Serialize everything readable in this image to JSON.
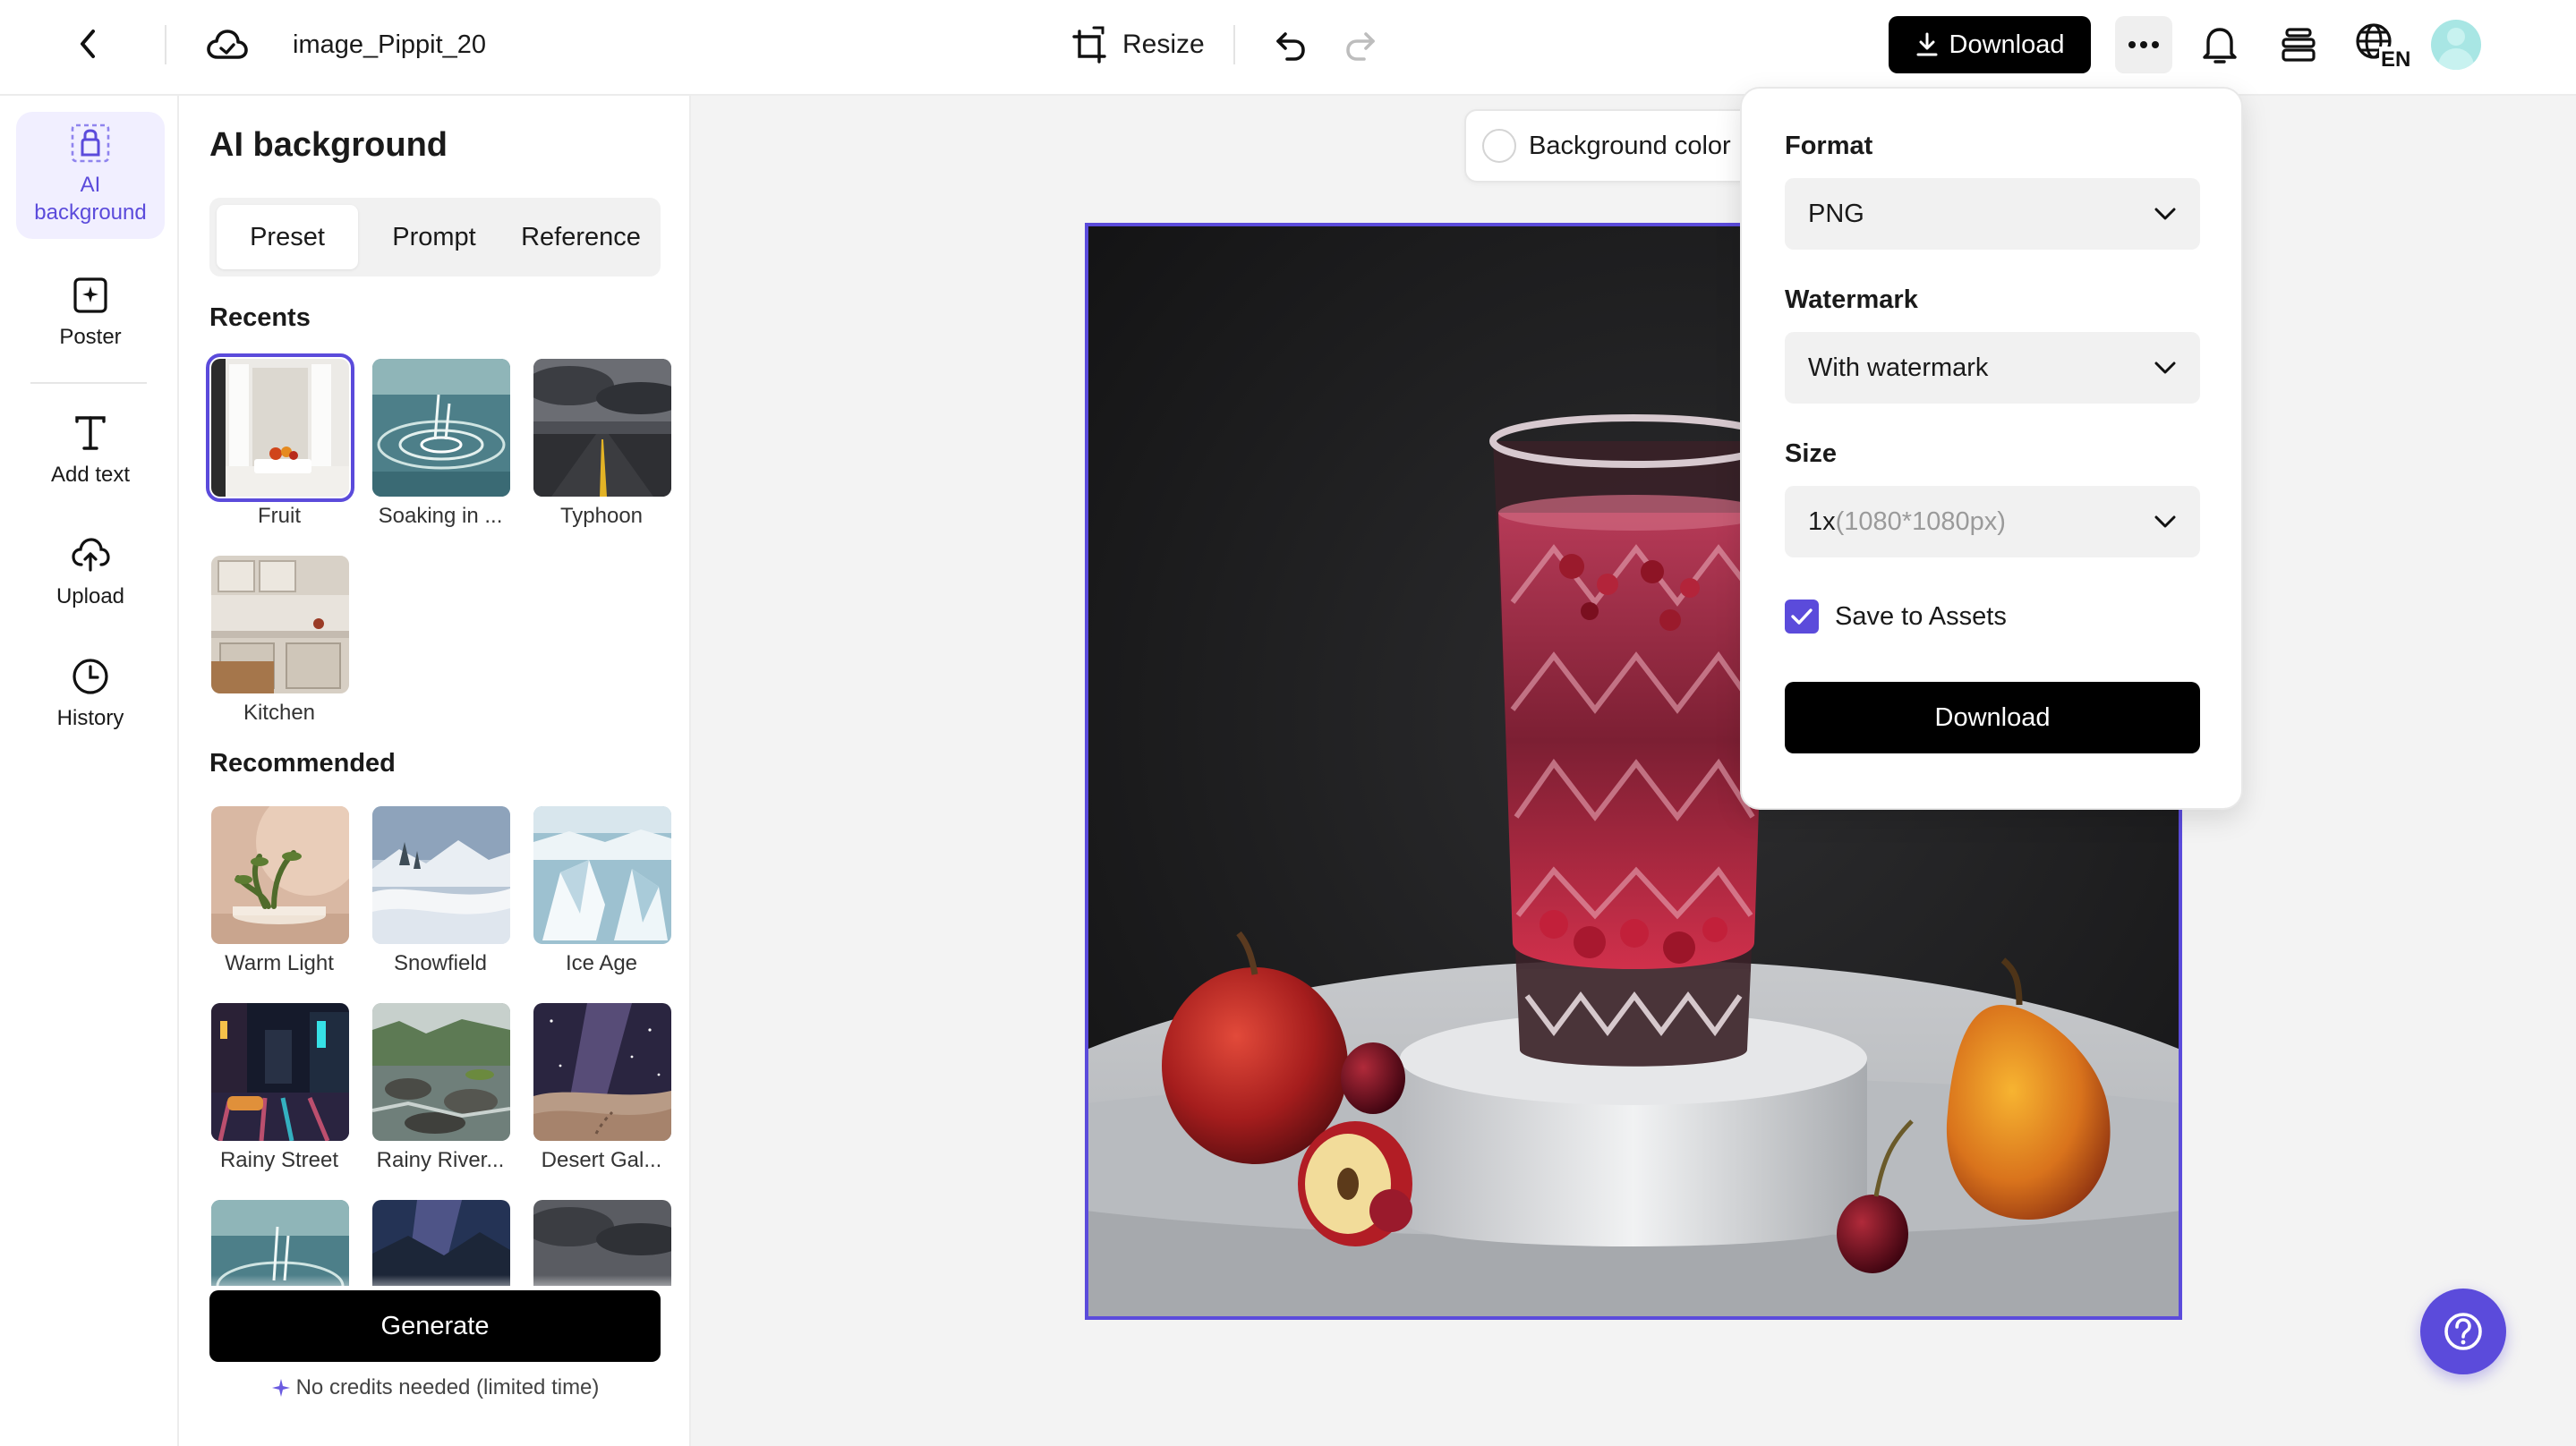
{
  "header": {
    "file_name": "image_Pippit_20",
    "resize_label": "Resize",
    "download_label": "Download",
    "language_code": "EN"
  },
  "rail": {
    "items": [
      {
        "label": "AI background",
        "icon": "ai-background-icon",
        "active": true
      },
      {
        "label": "Poster",
        "icon": "poster-icon"
      },
      {
        "label": "Add text",
        "icon": "text-icon"
      },
      {
        "label": "Upload",
        "icon": "cloud-upload-icon"
      },
      {
        "label": "History",
        "icon": "clock-icon"
      }
    ]
  },
  "panel": {
    "title": "AI background",
    "tabs": [
      {
        "label": "Preset",
        "active": true
      },
      {
        "label": "Prompt"
      },
      {
        "label": "Reference"
      }
    ],
    "recents_label": "Recents",
    "recents": [
      {
        "label": "Fruit",
        "selected": true
      },
      {
        "label": "Soaking in ..."
      },
      {
        "label": "Typhoon"
      },
      {
        "label": "Kitchen"
      }
    ],
    "recommended_label": "Recommended",
    "recommended": [
      {
        "label": "Warm Light"
      },
      {
        "label": "Snowfield"
      },
      {
        "label": "Ice Age"
      },
      {
        "label": "Rainy Street"
      },
      {
        "label": "Rainy River..."
      },
      {
        "label": "Desert Gal..."
      }
    ],
    "generate_label": "Generate",
    "credits_note": "No credits needed (limited time)"
  },
  "canvas": {
    "background_color_label": "Background color"
  },
  "download_menu": {
    "format_label": "Format",
    "format_value": "PNG",
    "watermark_label": "Watermark",
    "watermark_value": "With watermark",
    "size_label": "Size",
    "size_value_main": "1x",
    "size_value_detail": "(1080*1080px)",
    "save_to_assets_label": "Save to Assets",
    "save_to_assets_checked": true,
    "download_label": "Download"
  },
  "colors": {
    "accent": "#5b4bdb",
    "primary_button": "#000000",
    "canvas_bg": "#f3f3f3"
  }
}
